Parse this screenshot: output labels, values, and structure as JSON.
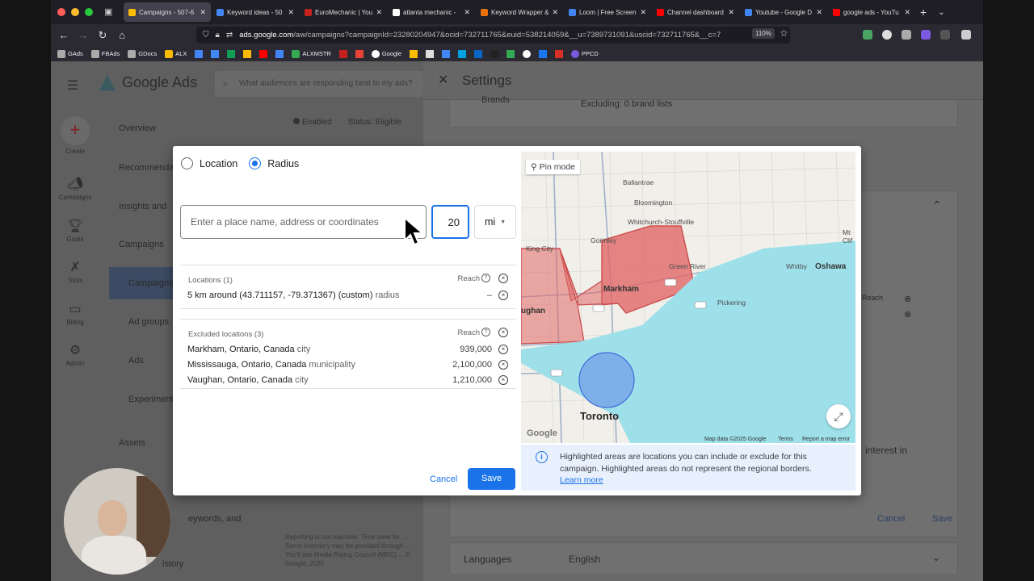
{
  "browser": {
    "tabs": [
      {
        "title": "Campaigns - 507-6",
        "color": "#fbbc04",
        "active": true
      },
      {
        "title": "Keyword ideas - 50",
        "color": "#4285f4",
        "active": false
      },
      {
        "title": "EuroMechanic | You",
        "color": "#c5221f",
        "active": false
      },
      {
        "title": "atlanta mechanic -",
        "color": "#ffffff",
        "active": false
      },
      {
        "title": "Keyword Wrapper &",
        "color": "#e8710a",
        "active": false
      },
      {
        "title": "Loom | Free Screen",
        "color": "#4285f4",
        "active": false
      },
      {
        "title": "Channel dashboard",
        "color": "#ff0000",
        "active": false
      },
      {
        "title": "Youtube - Google D",
        "color": "#4285f4",
        "active": false
      },
      {
        "title": "google ads - YouTu",
        "color": "#ff0000",
        "active": false
      }
    ],
    "url_domain": "ads.google.com",
    "url_path": "/aw/campaigns?campaignId=23280204947&ocid=732711765&euid=538214059&__u=7389731091&uscid=732711765&__c=7",
    "url_prefix": "",
    "zoom": "110%",
    "bookmarks": [
      "GAds",
      "FBAds",
      "GDocs",
      "ALX",
      "ALXMSTR",
      "Google",
      "PPCD"
    ]
  },
  "gads": {
    "logo": "Google Ads",
    "search_placeholder": "What audiences are responding best to my ads?",
    "rail": [
      "Create",
      "Campaigns",
      "Goals",
      "Tools",
      "Billing",
      "Admin"
    ],
    "sidenav": [
      "Overview",
      "Recommenda",
      "Insights and",
      "Campaigns",
      "Campaigns",
      "Ad groups",
      "Ads",
      "Experiment",
      "Assets",
      "eywords, and",
      "istory"
    ],
    "status_enabled": "Enabled",
    "status_label": "Status: Eligible",
    "footnote": "Reporting is not real-time. Time zone for ... Some inventory may be provided through ... You'll see Media Rating Council (MRC) ... © Google, 2025"
  },
  "settings": {
    "title": "Settings",
    "brands_label": "Brands",
    "brands_value": "Excluding: 0 brand lists",
    "reach_label": "Reach",
    "interest_text": "interest in",
    "cancel": "Cancel",
    "save": "Save",
    "languages_label": "Languages",
    "languages_value": "English"
  },
  "modal": {
    "radio_location": "Location",
    "radio_radius": "Radius",
    "place_placeholder": "Enter a place name, address or coordinates",
    "radius_value": "20",
    "unit": "mi",
    "locations_header": "Locations (1)",
    "reach_label": "Reach",
    "locations": [
      {
        "name": "5 km around (43.711157, -79.371367) (custom)",
        "type": "radius",
        "reach": "–"
      }
    ],
    "excluded_header": "Excluded locations (3)",
    "excluded": [
      {
        "name": "Markham, Ontario, Canada",
        "type": "city",
        "reach": "939,000"
      },
      {
        "name": "Mississauga, Ontario, Canada",
        "type": "municipality",
        "reach": "2,100,000"
      },
      {
        "name": "Vaughan, Ontario, Canada",
        "type": "city",
        "reach": "1,210,000"
      }
    ],
    "cancel": "Cancel",
    "save": "Save",
    "map": {
      "pin_mode": "Pin mode",
      "labels": [
        "Ballantrae",
        "Bloomington",
        "Whitchurch-Stouffville",
        "Gormley",
        "King City",
        "Markham",
        "Green River",
        "Whitby",
        "Oshawa",
        "Pickering",
        "Toronto",
        "Mt",
        "Clif",
        "ughan"
      ],
      "footer_data": "Map data ©2025 Google",
      "footer_terms": "Terms",
      "footer_report": "Report a map error",
      "watermark": "Google"
    },
    "info_text": "Highlighted areas are locations you can include or exclude for this campaign. Highlighted areas do not represent the regional borders.",
    "learn_more": "Learn more"
  }
}
